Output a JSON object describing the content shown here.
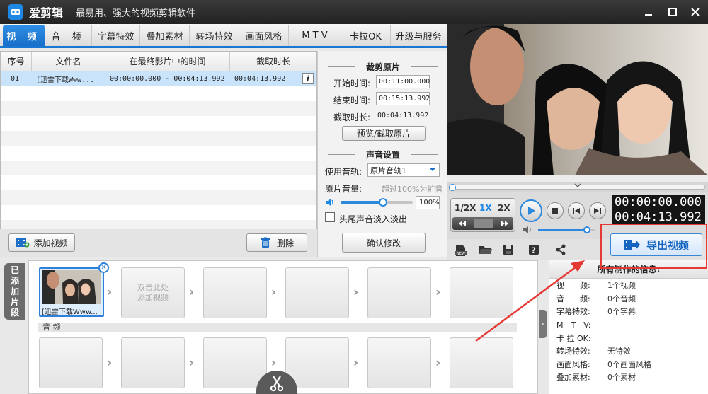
{
  "app": {
    "name": "爱剪辑",
    "slogan": "最易用、强大的视频剪辑软件"
  },
  "tabs": [
    {
      "label": "视 频",
      "active": true
    },
    {
      "label": "音 频"
    },
    {
      "label": "字幕特效"
    },
    {
      "label": "叠加素材"
    },
    {
      "label": "转场特效"
    },
    {
      "label": "画面风格"
    },
    {
      "label": "M T V"
    },
    {
      "label": "卡拉OK"
    },
    {
      "label": "升级与服务"
    }
  ],
  "file_table": {
    "headers": [
      "序号",
      "文件名",
      "在最终影片中的时间",
      "截取时长"
    ],
    "rows": [
      {
        "index": "01",
        "name": "[迅雷下载Www...",
        "time_range": "00:00:00.000 - 00:04:13.992",
        "duration": "00:04:13.992"
      }
    ]
  },
  "buttons": {
    "add_video": "添加视频",
    "delete": "删除",
    "preview_cut": "预览/截取原片",
    "confirm": "确认修改",
    "export": "导出视频"
  },
  "clip_settings": {
    "cut_title": "裁剪原片",
    "start_label": "开始时间:",
    "start_value": "00:11:00.000",
    "end_label": "结束时间:",
    "end_value": "00:15:13.992",
    "duration_label": "截取时长:",
    "duration_value": "00:04:13.992",
    "audio_title": "声音设置",
    "track_label": "使用音轨:",
    "track_value": "原片音轨1",
    "volume_label": "原片音量:",
    "volume_hint": "超过100%为扩音",
    "volume_value": "100%",
    "volume_level": 0.6,
    "fade_label": "头尾声音淡入淡出"
  },
  "player": {
    "speeds": [
      "1/2X",
      "1X",
      "2X"
    ],
    "current_speed": "1X",
    "current_time": "00:00:00.000",
    "total_time": "00:04:13.992",
    "volume_level": 0.88
  },
  "timeline": {
    "side_label": "已添加片段",
    "clip_name": "[迅雷下载Www...",
    "empty_slot_hint": "双击此处\n添加视频",
    "audio_label": "音 频"
  },
  "info_panel": {
    "title": "所有制作的信息:",
    "rows": [
      {
        "key": "视　　频:",
        "value": "1个视频"
      },
      {
        "key": "音　　频:",
        "value": "0个音频"
      },
      {
        "key": "字幕特效:",
        "value": "0个字幕"
      },
      {
        "key": "M　T　V:",
        "value": ""
      },
      {
        "key": "卡 拉 OK:",
        "value": ""
      },
      {
        "key": "转场特效:",
        "value": "无特效"
      },
      {
        "key": "画面风格:",
        "value": "0个画面风格"
      },
      {
        "key": "叠加素材:",
        "value": "0个素材"
      }
    ]
  },
  "colors": {
    "accent": "#1976d2",
    "highlight": "#e53935"
  }
}
